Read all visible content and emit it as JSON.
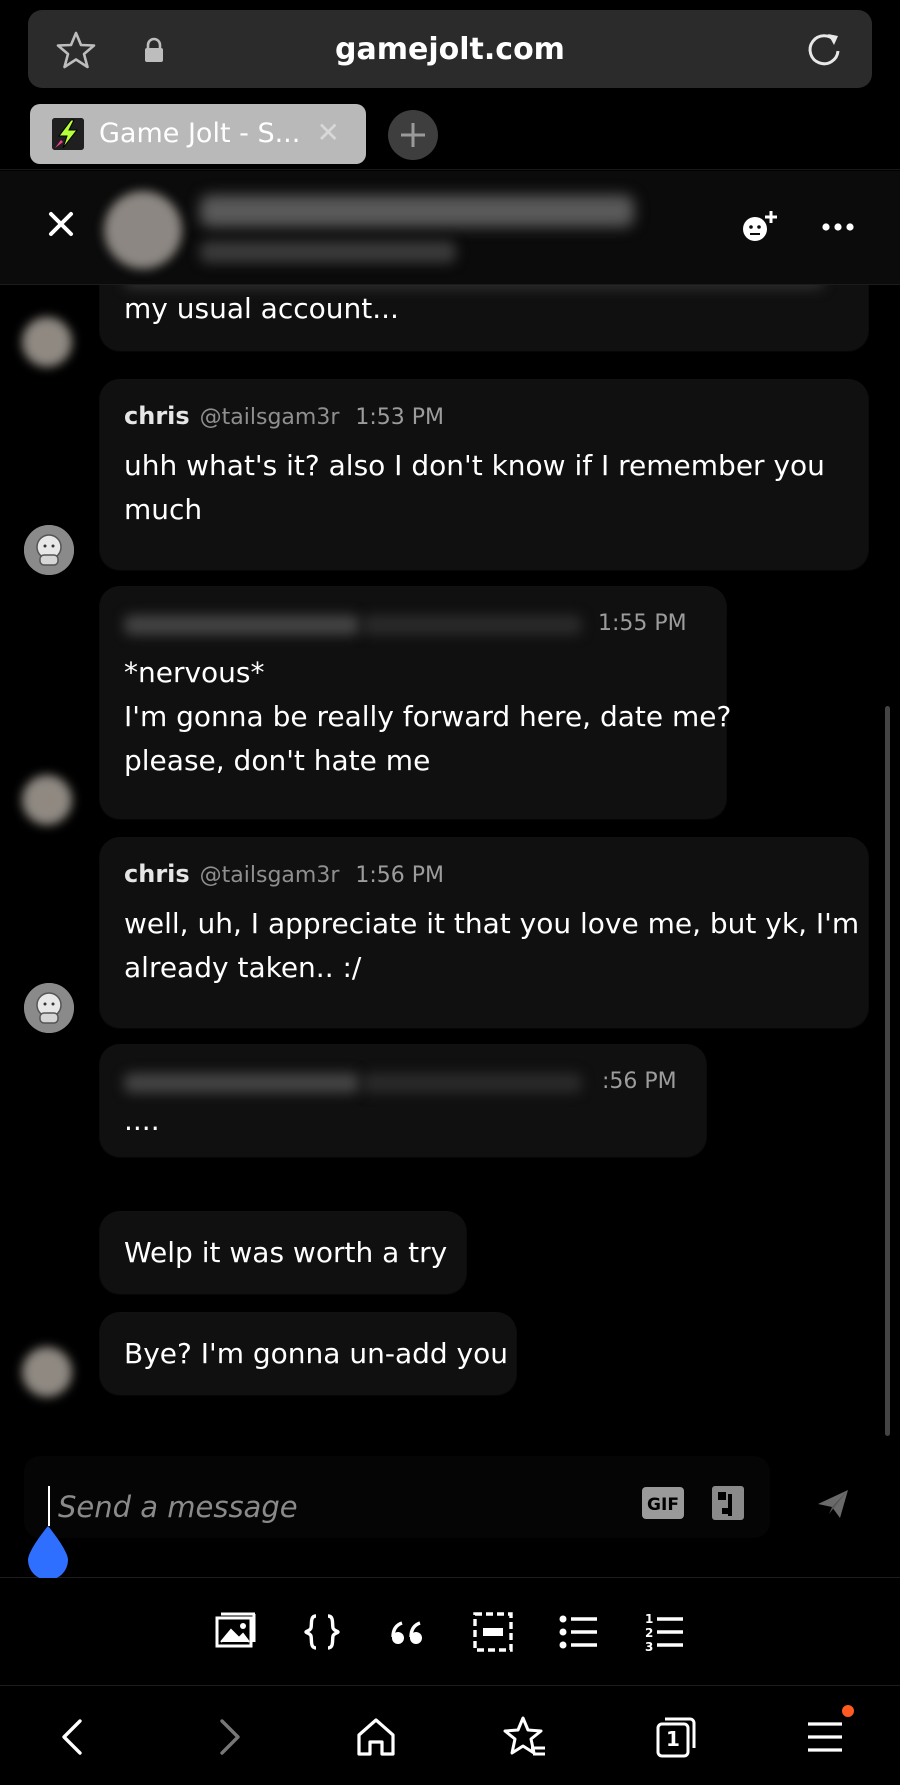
{
  "browser": {
    "url": "gamejolt.com",
    "tab_title": "Game Jolt - S...",
    "tab_close": "✕"
  },
  "chat": {
    "messages": [
      {
        "text_lines": [
          "my usual account..."
        ]
      },
      {
        "author": "chris",
        "handle": "@tailsgam3r",
        "time": "1:53 PM",
        "text_lines": [
          "uhh what's it? also I don't know if I remember you",
          "much"
        ]
      },
      {
        "time": "1:55 PM",
        "text_lines": [
          "*nervous*",
          "I'm gonna be really forward here, date me?",
          "please, don't hate me"
        ]
      },
      {
        "author": "chris",
        "handle": "@tailsgam3r",
        "time": "1:56 PM",
        "text_lines": [
          "well, uh, I appreciate it that you love me, but yk, I'm",
          "already taken.. :/"
        ]
      },
      {
        "time": ":56 PM",
        "text_lines": [
          "...."
        ]
      },
      {
        "text_lines": [
          "Welp it was worth a try"
        ]
      },
      {
        "text_lines": [
          "Bye? I'm gonna un-add you"
        ]
      }
    ]
  },
  "input": {
    "placeholder": "Send a message",
    "gif_label": "GIF"
  },
  "colors": {
    "accent_blue": "#2f6fff",
    "badge_orange": "#ff5a1f",
    "bubble_bg": "#101010"
  },
  "icons": {
    "header": [
      "close-icon",
      "add-friend-icon",
      "more-icon"
    ],
    "format_toolbar": [
      "image-icon",
      "code-icon",
      "quote-icon",
      "spoiler-icon",
      "bullet-list-icon",
      "numbered-list-icon"
    ],
    "bottom_nav": [
      "back-icon",
      "forward-icon",
      "home-icon",
      "bookmarks-icon",
      "tabs-icon",
      "menu-icon"
    ]
  },
  "tabs_count": "1"
}
